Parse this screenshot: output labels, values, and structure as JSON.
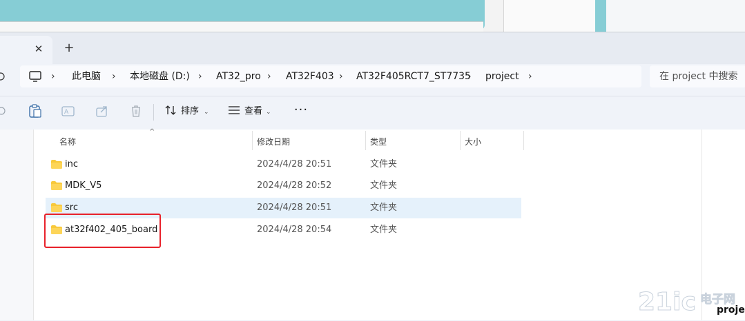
{
  "tabs": {
    "close_glyph": "✕",
    "new_glyph": "+"
  },
  "address": {
    "items": [
      "此电脑",
      "本地磁盘 (D:)",
      "AT32_pro",
      "AT32F403",
      "AT32F405RCT7_ST7735",
      "project"
    ],
    "separator": "›"
  },
  "search": {
    "placeholder": "在 project 中搜索"
  },
  "toolbar": {
    "sort_label": "排序",
    "view_label": "查看",
    "more_label": "···"
  },
  "columns": {
    "name": "名称",
    "date": "修改日期",
    "type": "类型",
    "size": "大小"
  },
  "files": [
    {
      "name": "inc",
      "date": "2024/4/28 20:51",
      "type": "文件夹"
    },
    {
      "name": "MDK_V5",
      "date": "2024/4/28 20:52",
      "type": "文件夹"
    },
    {
      "name": "src",
      "date": "2024/4/28 20:51",
      "type": "文件夹"
    },
    {
      "name": "at32f402_405_board",
      "date": "2024/4/28 20:54",
      "type": "文件夹"
    }
  ],
  "watermark": {
    "logo_text": "21ic电子网",
    "caption": "proje"
  },
  "colors": {
    "highlight": "#e8212a",
    "folder": "#f8c93b",
    "selected_row": "#e5f1fb",
    "accent_window": "#86cdd5"
  }
}
